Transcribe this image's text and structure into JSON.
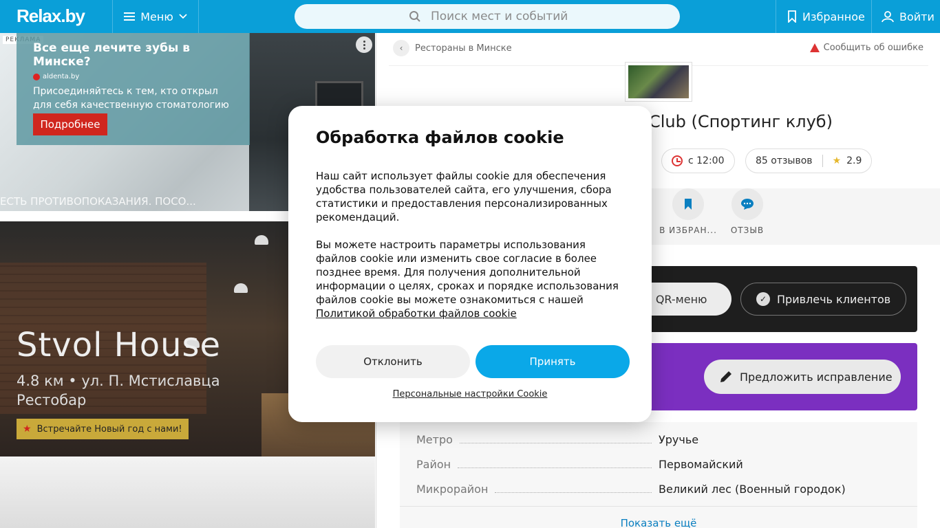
{
  "header": {
    "logo": "Relax.by",
    "menu_label": "Меню",
    "search_placeholder": "Поиск мест и событий",
    "favorites_label": "Избранное",
    "login_label": "Войти"
  },
  "ad": {
    "badge": "РЕКЛАМА",
    "title": "Все еще лечите зубы в Минске?",
    "source": "aldenta.by",
    "text": "Присоединяйтесь к тем, кто открыл для себя качественную стоматологию",
    "button": "Подробнее",
    "disclaimer": "ЕСТЬ ПРОТИВОПОКАЗАНИЯ. ПОСО..."
  },
  "venue": {
    "name": "Stvol House",
    "distance_address": "4.8 км • ул. П. Мстиславца",
    "type": "Рестобар",
    "badge": "Встречайте Новый год с нами!"
  },
  "page": {
    "breadcrumb": "Рестораны в Минске",
    "report": "Сообщить об ошибке",
    "title_visible": "Club (Спортинг клуб)",
    "hours": "с 12:00",
    "reviews": "85 отзывов",
    "rating": "2.9",
    "actions": [
      {
        "label": "В ИЗБРАН..."
      },
      {
        "label": "ОТЗЫВ"
      }
    ],
    "qr_button": "ть QR-меню",
    "clients_button": "Привлечь клиентов",
    "suggest_button": "Предложить исправление",
    "info": [
      {
        "key": "Метро",
        "value": "Уручье"
      },
      {
        "key": "Район",
        "value": "Первомайский"
      },
      {
        "key": "Микрорайон",
        "value": "Великий лес (Военный городок)"
      }
    ],
    "show_more": "Показать ещё"
  },
  "cookie": {
    "title": "Обработка файлов cookie",
    "p1": "Наш сайт использует файлы cookie для обеспечения удобства пользователей сайта, его улучшения, сбора статистики и предоставления персонализированных рекомендаций.",
    "p2": "Вы можете настроить параметры использования файлов cookie или изменить свое согласие в более позднее время. Для получения дополнительной информации о целях, сроках и порядке использования файлов cookie вы можете ознакомиться с нашей",
    "policy_link": "Политикой обработки файлов cookie",
    "decline": "Отклонить",
    "accept": "Принять",
    "settings": "Персональные настройки Cookie"
  },
  "colors": {
    "header_bg": "#0a9fd8",
    "accept_bg": "#0aa8e8",
    "ad_button": "#d0261e",
    "purple_block": "#7b2fc0"
  }
}
